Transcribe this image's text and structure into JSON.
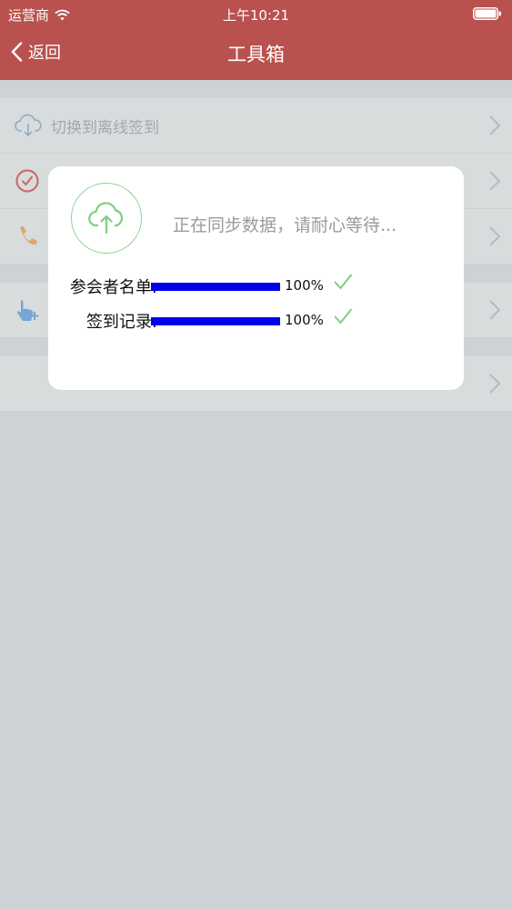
{
  "status_bar": {
    "carrier": "运营商",
    "time": "上午10:21"
  },
  "nav": {
    "back_label": "返回",
    "title": "工具箱"
  },
  "list": {
    "items": [
      {
        "label": "切换到离线签到",
        "icon": "cloud-download-icon"
      },
      {
        "label": "",
        "icon": "clock-check-icon"
      },
      {
        "label": "",
        "icon": "phone-icon"
      },
      {
        "label": "",
        "icon": "hand-pointer-icon"
      },
      {
        "label": "",
        "icon": ""
      }
    ]
  },
  "dialog": {
    "message": "正在同步数据，请耐心等待...",
    "icon": "cloud-upload-icon",
    "progress": [
      {
        "label": "参会者名单:",
        "percent_text": "100%",
        "value": 1.0
      },
      {
        "label": "签到记录:",
        "percent_text": "100%",
        "value": 1.0
      }
    ]
  },
  "colors": {
    "nav_background": "#b9514e",
    "progress_fill": "#0000ee",
    "check_green": "#7fcf7f"
  }
}
